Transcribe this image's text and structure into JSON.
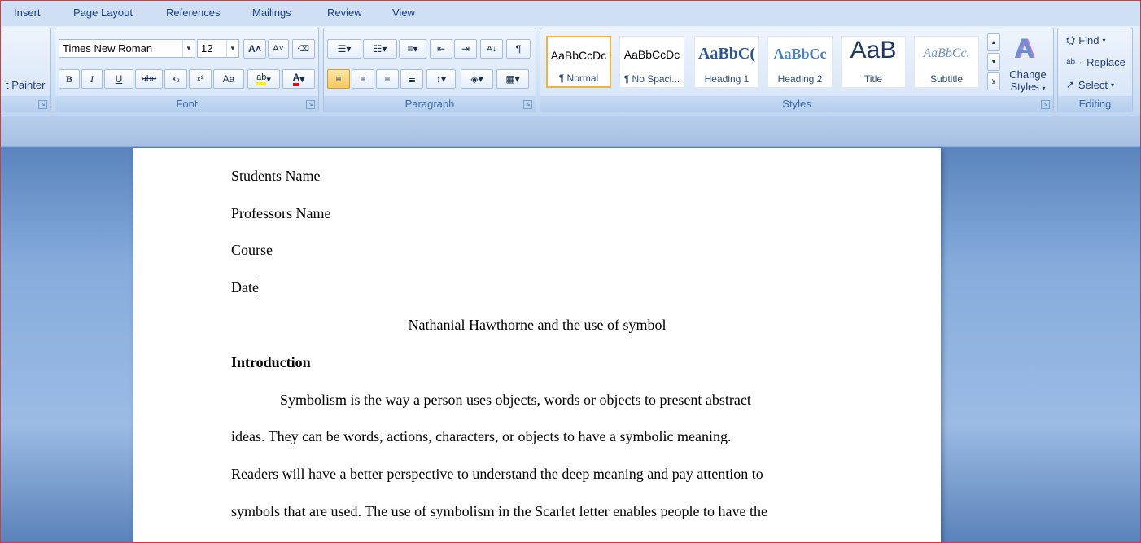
{
  "tabs": [
    "Insert",
    "Page Layout",
    "References",
    "Mailings",
    "Review",
    "View"
  ],
  "clipboard": {
    "format_painter": "t Painter"
  },
  "font": {
    "name": "Times New Roman",
    "size": "12",
    "group_label": "Font",
    "buttons": [
      "B",
      "I",
      "U",
      "abe",
      "x₂",
      "x²",
      "Aa"
    ]
  },
  "paragraph": {
    "group_label": "Paragraph"
  },
  "styles": {
    "group_label": "Styles",
    "items": [
      {
        "sample": "AaBbCcDc",
        "name": "¶ Normal",
        "selected": true
      },
      {
        "sample": "AaBbCcDc",
        "name": "¶ No Spaci..."
      },
      {
        "sample": "AaBbC(",
        "name": "Heading 1"
      },
      {
        "sample": "AaBbCc",
        "name": "Heading 2"
      },
      {
        "sample": "AaB",
        "name": "Title"
      },
      {
        "sample": "AaBbCc.",
        "name": "Subtitle"
      }
    ],
    "change_styles": [
      "Change",
      "Styles"
    ]
  },
  "editing": {
    "group_label": "Editing",
    "find": "Find",
    "replace": "Replace",
    "select": "Select"
  },
  "document": {
    "lines": [
      "Students Name",
      "Professors Name",
      "Course",
      "Date",
      "Nathanial Hawthorne and the use of symbol",
      "Introduction",
      "Symbolism is the way a person uses objects, words or objects to present abstract",
      "ideas. They can be words, actions, characters, or objects to have a symbolic meaning.",
      "Readers will have a better perspective to understand the deep meaning and pay attention to",
      "symbols that are used. The use of symbolism in the Scarlet letter enables people to have the"
    ]
  },
  "colors": {
    "accent": "#f2b33d",
    "ribbon": "#cfe0f4",
    "text": "#15428b"
  }
}
